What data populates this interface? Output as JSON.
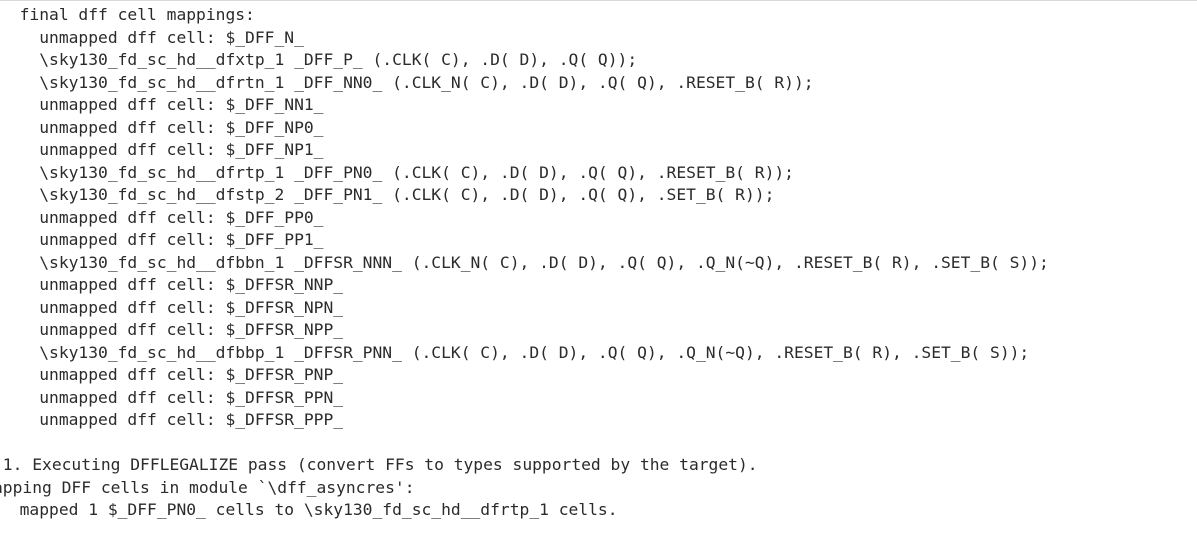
{
  "terminal": {
    "lines": [
      {
        "text": "  final dff cell mappings:"
      },
      {
        "text": "    unmapped dff cell: $_DFF_N_"
      },
      {
        "text": "    \\sky130_fd_sc_hd__dfxtp_1 _DFF_P_ (.CLK( C), .D( D), .Q( Q));"
      },
      {
        "text": "    \\sky130_fd_sc_hd__dfrtn_1 _DFF_NN0_ (.CLK_N( C), .D( D), .Q( Q), .RESET_B( R));"
      },
      {
        "text": "    unmapped dff cell: $_DFF_NN1_"
      },
      {
        "text": "    unmapped dff cell: $_DFF_NP0_"
      },
      {
        "text": "    unmapped dff cell: $_DFF_NP1_"
      },
      {
        "text": "    \\sky130_fd_sc_hd__dfrtp_1 _DFF_PN0_ (.CLK( C), .D( D), .Q( Q), .RESET_B( R));"
      },
      {
        "text": "    \\sky130_fd_sc_hd__dfstp_2 _DFF_PN1_ (.CLK( C), .D( D), .Q( Q), .SET_B( R));"
      },
      {
        "text": "    unmapped dff cell: $_DFF_PP0_"
      },
      {
        "text": "    unmapped dff cell: $_DFF_PP1_"
      },
      {
        "text": "    \\sky130_fd_sc_hd__dfbbn_1 _DFFSR_NNN_ (.CLK_N( C), .D( D), .Q( Q), .Q_N(~Q), .RESET_B( R), .SET_B( S));"
      },
      {
        "text": "    unmapped dff cell: $_DFFSR_NNP_"
      },
      {
        "text": "    unmapped dff cell: $_DFFSR_NPN_"
      },
      {
        "text": "    unmapped dff cell: $_DFFSR_NPP_"
      },
      {
        "text": "    \\sky130_fd_sc_hd__dfbbp_1 _DFFSR_PNN_ (.CLK( C), .D( D), .Q( Q), .Q_N(~Q), .RESET_B( R), .SET_B( S));"
      },
      {
        "text": "    unmapped dff cell: $_DFFSR_PNP_"
      },
      {
        "text": "    unmapped dff cell: $_DFFSR_PPN_"
      },
      {
        "text": "    unmapped dff cell: $_DFFSR_PPP_"
      },
      {
        "text": ""
      },
      {
        "text": ".1. Executing DFFLEGALIZE pass (convert FFs to types supported by the target).",
        "clip": true
      },
      {
        "text": "apping DFF cells in module `\\dff_asyncres':",
        "clip": true
      },
      {
        "text": "  mapped 1 $_DFF_PN0_ cells to \\sky130_fd_sc_hd__dfrtp_1 cells."
      }
    ]
  }
}
